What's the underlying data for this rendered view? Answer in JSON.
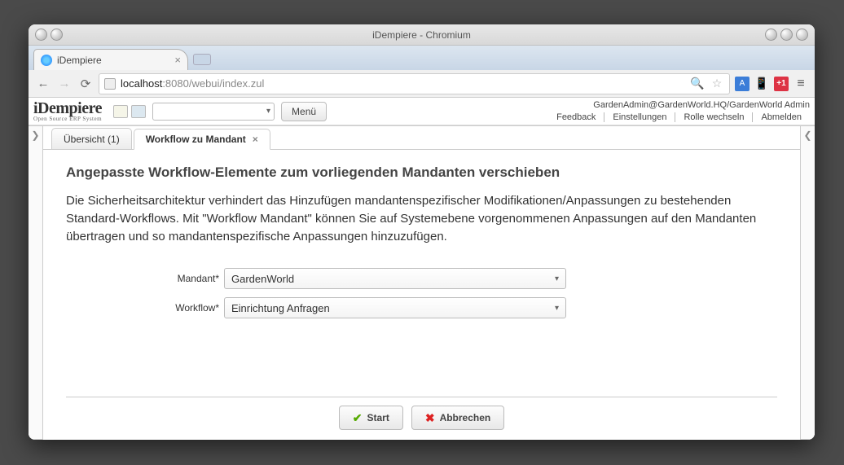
{
  "window": {
    "title": "iDempiere - Chromium"
  },
  "browser": {
    "tab_title": "iDempiere",
    "url_host": "localhost",
    "url_port_path": ":8080/webui/index.zul"
  },
  "app": {
    "logo_main": "iDempiere",
    "logo_sub": "Open Source ERP System",
    "menu_button": "Menü",
    "user_line": "GardenAdmin@GardenWorld.HQ/GardenWorld Admin",
    "links": {
      "feedback": "Feedback",
      "settings": "Einstellungen",
      "change_role": "Rolle wechseln",
      "logout": "Abmelden"
    }
  },
  "tabs": {
    "overview": "Übersicht (1)",
    "workflow": "Workflow zu Mandant"
  },
  "page": {
    "title": "Angepasste Workflow-Elemente zum vorliegenden Mandanten verschieben",
    "description": "Die Sicherheitsarchitektur verhindert das Hinzufügen mandantenspezifischer Modifikationen/Anpassungen zu bestehenden Standard-Workflows. Mit \"Workflow Mandant\" können Sie auf Systemebene vorgenommenen Anpassungen auf den Mandanten übertragen und so mandantenspezifische Anpassungen hinzuzufügen."
  },
  "form": {
    "mandant_label": "Mandant*",
    "mandant_value": "GardenWorld",
    "workflow_label": "Workflow*",
    "workflow_value": "Einrichtung Anfragen"
  },
  "buttons": {
    "start": "Start",
    "cancel": "Abbrechen"
  }
}
